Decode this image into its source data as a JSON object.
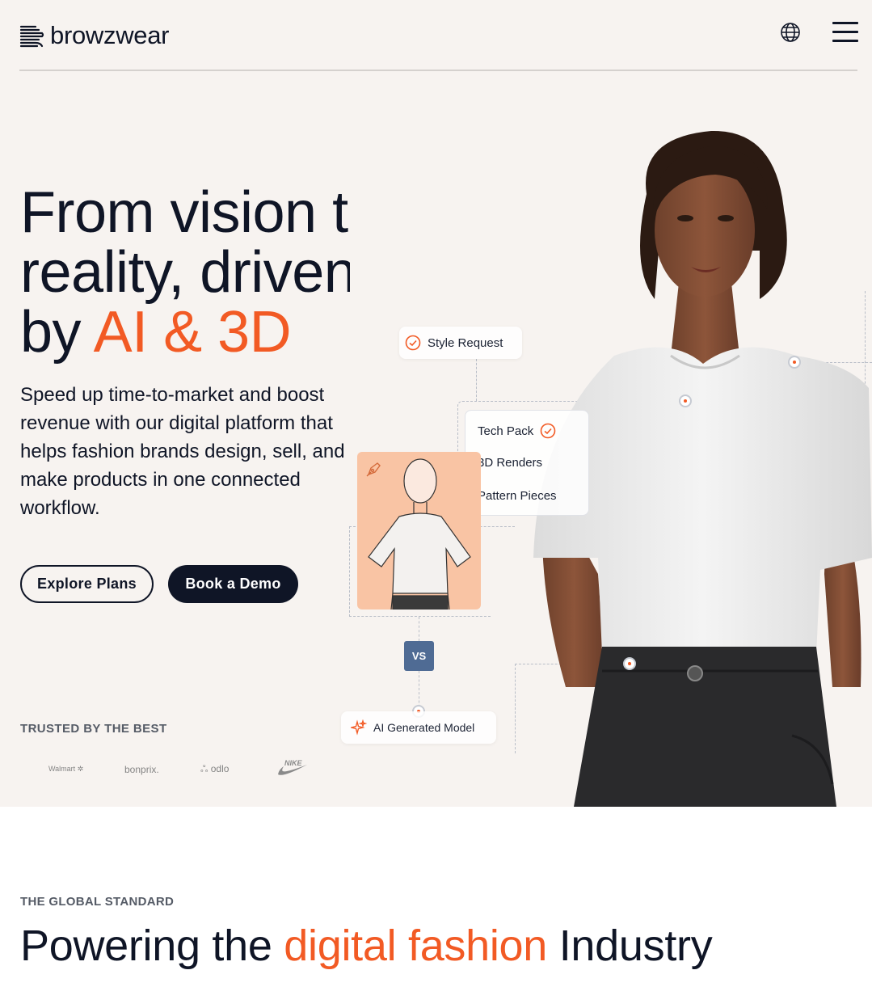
{
  "header": {
    "brand": "browzwear",
    "icons": {
      "logo": "browzwear-logo-icon",
      "language": "globe-icon",
      "menu": "hamburger-menu-icon"
    }
  },
  "hero": {
    "headline_lines": [
      "From vision to",
      "reality, driven",
      "by "
    ],
    "headline_accent": "AI & 3D",
    "subtext_lines": [
      "Speed up time-to-market and boost",
      "revenue with our digital platform that",
      "helps fashion brands design, sell, and",
      "make products in one connected",
      "workflow."
    ],
    "buttons": {
      "explore": "Explore Plans",
      "demo": "Book a Demo"
    },
    "trusted_label": "TRUSTED BY THE BEST",
    "brand_logos": [
      "Walmart",
      "bonprix.",
      "odlo",
      "NIKE"
    ]
  },
  "visual": {
    "style_request": "Style Request",
    "panel_items": [
      "Tech Pack",
      "3D Renders",
      "Pattern Pieces"
    ],
    "vs_label": "VS",
    "ai_model": "AI Generated Model"
  },
  "section": {
    "label": "THE GLOBAL STANDARD",
    "title_start": "Powering the ",
    "title_accent": "digital fashion",
    "title_end": " Industry"
  },
  "colors": {
    "accent": "#f25a24",
    "dark": "#0f1526",
    "hero_bg": "#f7f3f0"
  }
}
